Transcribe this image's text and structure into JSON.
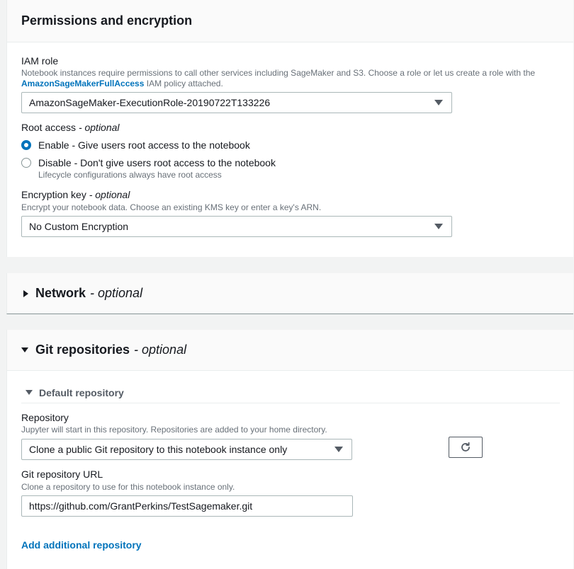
{
  "permissions": {
    "title": "Permissions and encryption",
    "iam_role": {
      "label": "IAM role",
      "desc_prefix": "Notebook instances require permissions to call other services including SageMaker and S3. Choose a role or let us create a role with the",
      "desc_link": "AmazonSageMakerFullAccess",
      "desc_suffix": "IAM policy attached.",
      "selected": "AmazonSageMaker-ExecutionRole-20190722T133226"
    },
    "root_access": {
      "label": "Root access",
      "optional": "- optional",
      "options": [
        {
          "label": "Enable - Give users root access to the notebook",
          "checked": true,
          "sub": ""
        },
        {
          "label": "Disable - Don't give users root access to the notebook",
          "checked": false,
          "sub": "Lifecycle configurations always have root access"
        }
      ]
    },
    "encryption": {
      "label": "Encryption key",
      "optional": "- optional",
      "desc": "Encrypt your notebook data. Choose an existing KMS key or enter a key's ARN.",
      "selected": "No Custom Encryption"
    }
  },
  "network": {
    "title": "Network",
    "optional": "- optional"
  },
  "git": {
    "title": "Git repositories",
    "optional": "- optional",
    "default_repo": {
      "title": "Default repository",
      "repository_label": "Repository",
      "repository_desc": "Jupyter will start in this repository. Repositories are added to your home directory.",
      "repository_selected": "Clone a public Git repository to this notebook instance only",
      "url_label": "Git repository URL",
      "url_desc": "Clone a repository to use for this notebook instance only.",
      "url_value": "https://github.com/GrantPerkins/TestSagemaker.git"
    },
    "add_link": "Add additional repository"
  },
  "colors": {
    "accent": "#0073bb",
    "text": "#16191f",
    "muted": "#687078",
    "border": "#aab7b8",
    "background": "#f2f3f3"
  },
  "icons": [
    "caret-down-icon",
    "radio-selected-icon",
    "radio-icon",
    "expand-right-icon",
    "collapse-down-icon",
    "refresh-icon"
  ]
}
